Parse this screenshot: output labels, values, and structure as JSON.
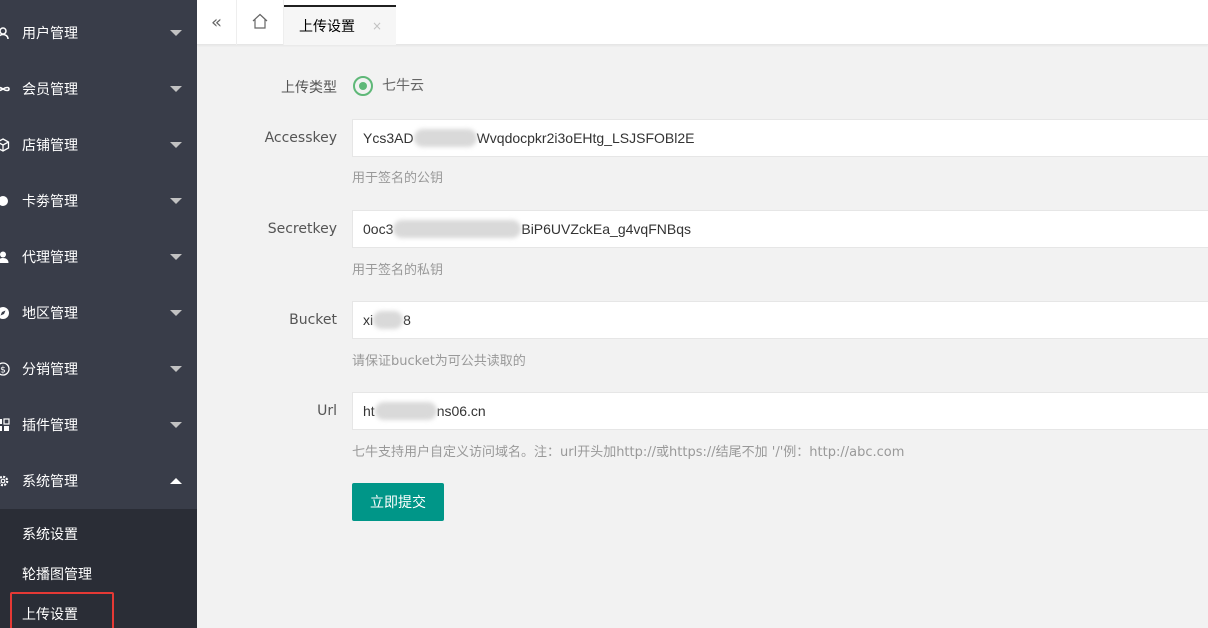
{
  "sidebar": {
    "items": [
      {
        "label": "用户管理",
        "icon": "users-icon"
      },
      {
        "label": "会员管理",
        "icon": "infinity-icon"
      },
      {
        "label": "店铺管理",
        "icon": "cube-icon"
      },
      {
        "label": "卡劵管理",
        "icon": "circle-icon"
      },
      {
        "label": "代理管理",
        "icon": "user-icon"
      },
      {
        "label": "地区管理",
        "icon": "compass-icon"
      },
      {
        "label": "分销管理",
        "icon": "dollar-icon"
      },
      {
        "label": "插件管理",
        "icon": "puzzle-icon"
      },
      {
        "label": "系统管理",
        "icon": "gear-icon"
      }
    ],
    "sub_items": [
      {
        "label": "系统设置"
      },
      {
        "label": "轮播图管理"
      },
      {
        "label": "上传设置"
      }
    ]
  },
  "topbar": {
    "collapse_glyph": "«",
    "tab_label": "上传设置",
    "tab_close": "×"
  },
  "form": {
    "upload_type_label": "上传类型",
    "upload_type_option": "七牛云",
    "accesskey_label": "Accesskey",
    "accesskey_prefix": "Ycs3AD",
    "accesskey_suffix": "Wvqdocpkr2i3oEHtg_LSJSFOBl2E",
    "accesskey_help": "用于签名的公钥",
    "secretkey_label": "Secretkey",
    "secretkey_prefix": "0oc3",
    "secretkey_suffix": "BiP6UVZckEa_g4vqFNBqs",
    "secretkey_help": "用于签名的私钥",
    "bucket_label": "Bucket",
    "bucket_prefix": "xi",
    "bucket_suffix": "8",
    "bucket_help": "请保证bucket为可公共读取的",
    "url_label": "Url",
    "url_prefix": "ht",
    "url_suffix": "ns06.cn",
    "url_help": "七牛支持用户自定义访问域名。注：url开头加http://或https://结尾不加 '/'例：http://abc.com",
    "submit_label": "立即提交"
  },
  "colors": {
    "sidebar_bg": "#393d49",
    "submenu_bg": "#2a2d36",
    "accent": "#009688",
    "radio": "#5fb878",
    "highlight_box": "#e53935"
  }
}
